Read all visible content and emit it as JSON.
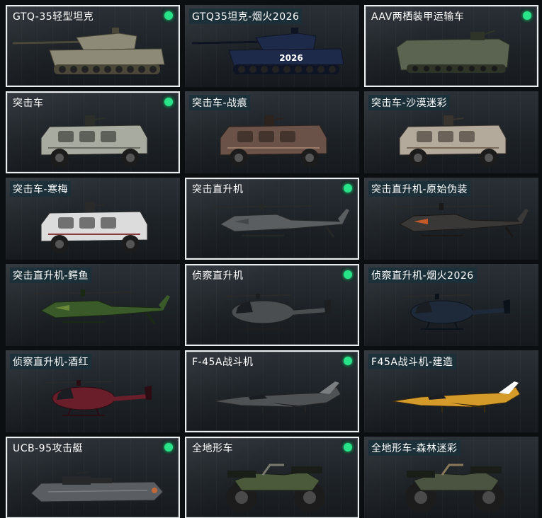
{
  "colors": {
    "owned_border": "#e9eef0",
    "owned_dot": "#27e488",
    "label_bg": "#1a303a"
  },
  "vehicles": [
    {
      "name": "GTQ-35轻型坦克",
      "owned": true,
      "icon": "tank-icon"
    },
    {
      "name": "GTQ35坦克-烟火2026",
      "owned": false,
      "icon": "tank-icon"
    },
    {
      "name": "AAV两栖装甲运输车",
      "owned": true,
      "icon": "amphibious-apc-icon"
    },
    {
      "name": "突击车",
      "owned": true,
      "icon": "assault-vehicle-icon"
    },
    {
      "name": "突击车-战痕",
      "owned": false,
      "icon": "assault-vehicle-icon"
    },
    {
      "name": "突击车-沙漠迷彩",
      "owned": false,
      "icon": "assault-vehicle-icon"
    },
    {
      "name": "突击车-寒梅",
      "owned": false,
      "icon": "assault-vehicle-icon"
    },
    {
      "name": "突击直升机",
      "owned": true,
      "icon": "attack-helicopter-icon"
    },
    {
      "name": "突击直升机-原始伪装",
      "owned": false,
      "icon": "attack-helicopter-icon"
    },
    {
      "name": "突击直升机-鳄鱼",
      "owned": false,
      "icon": "attack-helicopter-icon"
    },
    {
      "name": "侦察直升机",
      "owned": true,
      "icon": "scout-helicopter-icon"
    },
    {
      "name": "侦察直升机-烟火2026",
      "owned": false,
      "icon": "scout-helicopter-icon"
    },
    {
      "name": "侦察直升机-酒红",
      "owned": false,
      "icon": "scout-helicopter-icon"
    },
    {
      "name": "F-45A战斗机",
      "owned": true,
      "icon": "fighter-jet-icon"
    },
    {
      "name": "F45A战斗机-建造",
      "owned": false,
      "icon": "fighter-jet-icon"
    },
    {
      "name": "UCB-95攻击艇",
      "owned": true,
      "icon": "attack-boat-icon"
    },
    {
      "name": "全地形车",
      "owned": true,
      "icon": "atv-icon"
    },
    {
      "name": "全地形车-森林迷彩",
      "owned": false,
      "icon": "atv-icon"
    }
  ],
  "decal_text": "2026"
}
